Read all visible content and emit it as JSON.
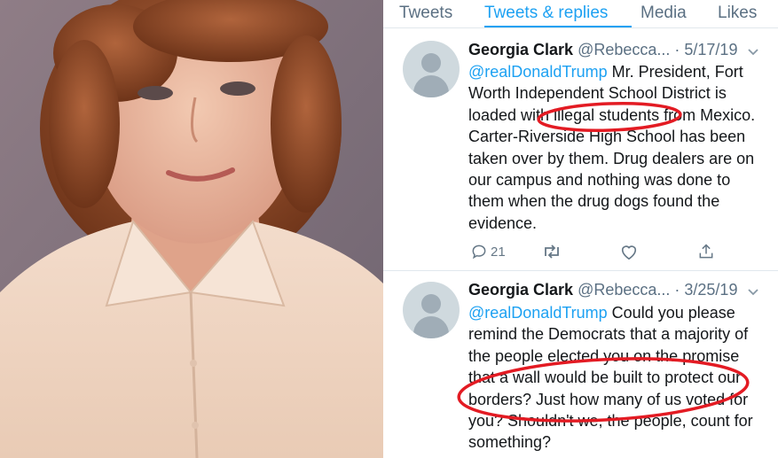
{
  "tabs": [
    {
      "label": "Tweets"
    },
    {
      "label": "Tweets & replies"
    },
    {
      "label": "Media"
    },
    {
      "label": "Likes"
    }
  ],
  "active_tab": "Tweets & replies",
  "accent_color": "#1da1f2",
  "annotation_color": "#e31b23",
  "tweets": [
    {
      "name": "Georgia Clark",
      "handle": "@Rebecca...",
      "date": "· 5/17/19",
      "mention": "@realDonaldTrump",
      "text": " Mr. President, Fort Worth Independent School District is loaded with illegal students from Mexico.  Carter-Riverside High School has been taken over by them.  Drug dealers are on our campus and nothing was done to them when the drug dogs found the evidence.",
      "reply_count": "21"
    },
    {
      "name": "Georgia Clark",
      "handle": "@Rebecca...",
      "date": "· 3/25/19",
      "mention": "@realDonaldTrump",
      "text": " Could you please remind the Democrats that a majority of the people elected you on the promise that a wall would be built to protect our borders? Just how many of us voted for you?  Shouldn't we, the people, count for something?"
    }
  ],
  "icons": [
    "reply-icon",
    "retweet-icon",
    "like-icon",
    "share-icon",
    "chevron-down-icon",
    "default-avatar-icon"
  ]
}
